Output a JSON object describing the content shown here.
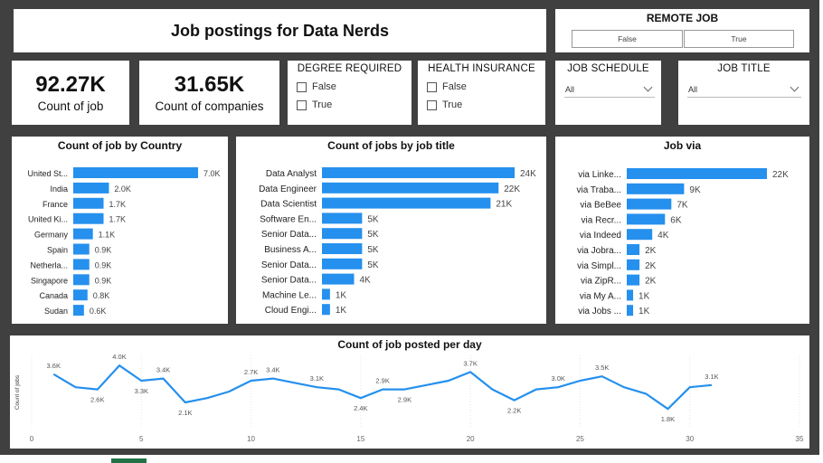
{
  "header": {
    "title": "Job postings for Data Nerds"
  },
  "remote": {
    "title": "REMOTE JOB",
    "options": [
      "False",
      "True"
    ]
  },
  "kpis": [
    {
      "value": "92.27K",
      "label": "Count of job"
    },
    {
      "value": "31.65K",
      "label": "Count of companies"
    }
  ],
  "degree": {
    "title": "DEGREE REQUIRED",
    "options": [
      "False",
      "True"
    ]
  },
  "health": {
    "title": "HEALTH INSURANCE",
    "options": [
      "False",
      "True"
    ]
  },
  "schedule": {
    "title": "JOB SCHEDULE",
    "value": "All"
  },
  "jobtitle": {
    "title": "JOB TITLE",
    "value": "All"
  },
  "colors": {
    "bar": "#2590ee",
    "background": "#404040"
  },
  "chart_data": [
    {
      "type": "bar",
      "orientation": "horizontal",
      "title": "Count of job by Country",
      "categories": [
        "United St...",
        "India",
        "France",
        "United Ki...",
        "Germany",
        "Spain",
        "Netherla...",
        "Singapore",
        "Canada",
        "Sudan"
      ],
      "values": [
        7.0,
        2.0,
        1.7,
        1.7,
        1.1,
        0.9,
        0.9,
        0.9,
        0.8,
        0.6
      ],
      "labels": [
        "7.0K",
        "2.0K",
        "1.7K",
        "1.7K",
        "1.1K",
        "0.9K",
        "0.9K",
        "0.9K",
        "0.8K",
        "0.6K"
      ],
      "max": 7.0
    },
    {
      "type": "bar",
      "orientation": "horizontal",
      "title": "Count of jobs by job title",
      "categories": [
        "Data Analyst",
        "Data Engineer",
        "Data Scientist",
        "Software En...",
        "Senior Data...",
        "Business A...",
        "Senior Data...",
        "Senior Data...",
        "Machine Le...",
        "Cloud Engi..."
      ],
      "values": [
        24,
        22,
        21,
        5,
        5,
        5,
        5,
        4,
        1,
        1
      ],
      "labels": [
        "24K",
        "22K",
        "21K",
        "5K",
        "5K",
        "5K",
        "5K",
        "4K",
        "1K",
        "1K"
      ],
      "max": 24
    },
    {
      "type": "bar",
      "orientation": "horizontal",
      "title": "Job via",
      "categories": [
        "via Linke...",
        "via Traba...",
        "via BeBee",
        "via Recr...",
        "via Indeed",
        "via Jobra...",
        "via Simpl...",
        "via ZipR...",
        "via My A...",
        "via Jobs ..."
      ],
      "values": [
        22,
        9,
        7,
        6,
        4,
        2,
        2,
        2,
        1,
        1
      ],
      "labels": [
        "22K",
        "9K",
        "7K",
        "6K",
        "4K",
        "2K",
        "2K",
        "2K",
        "1K",
        "1K"
      ],
      "max": 22
    },
    {
      "type": "line",
      "title": "Count of job posted per day",
      "ylabel": "Count of jobs",
      "xlabel": "",
      "x": [
        1,
        2,
        3,
        4,
        5,
        6,
        7,
        8,
        9,
        10,
        11,
        12,
        13,
        14,
        15,
        16,
        17,
        18,
        19,
        20,
        21,
        22,
        23,
        24,
        25,
        26,
        27,
        28,
        29,
        30,
        31
      ],
      "y": [
        3.6,
        3.0,
        2.9,
        4.0,
        3.3,
        3.4,
        2.3,
        2.5,
        2.8,
        3.3,
        3.4,
        3.2,
        3.0,
        2.9,
        2.5,
        2.9,
        2.9,
        3.1,
        3.3,
        3.7,
        2.9,
        2.4,
        2.9,
        3.0,
        3.3,
        3.5,
        3.0,
        2.7,
        2.0,
        3.0,
        3.1
      ],
      "point_labels": [
        {
          "x": 1,
          "text": "3.6K",
          "pos": "above"
        },
        {
          "x": 3,
          "text": "2.6K",
          "pos": "below"
        },
        {
          "x": 4,
          "text": "4.0K",
          "pos": "above"
        },
        {
          "x": 5,
          "text": "3.3K",
          "pos": "below"
        },
        {
          "x": 6,
          "text": "3.4K",
          "pos": "above"
        },
        {
          "x": 7,
          "text": "2.1K",
          "pos": "below"
        },
        {
          "x": 10,
          "text": "2.7K",
          "pos": "above"
        },
        {
          "x": 11,
          "text": "3.4K",
          "pos": "above"
        },
        {
          "x": 13,
          "text": "3.1K",
          "pos": "above"
        },
        {
          "x": 15,
          "text": "2.4K",
          "pos": "below"
        },
        {
          "x": 16,
          "text": "2.9K",
          "pos": "above"
        },
        {
          "x": 17,
          "text": "2.9K",
          "pos": "below"
        },
        {
          "x": 20,
          "text": "3.7K",
          "pos": "above"
        },
        {
          "x": 22,
          "text": "2.2K",
          "pos": "below"
        },
        {
          "x": 24,
          "text": "3.0K",
          "pos": "above"
        },
        {
          "x": 26,
          "text": "3.5K",
          "pos": "above"
        },
        {
          "x": 29,
          "text": "1.8K",
          "pos": "below"
        },
        {
          "x": 31,
          "text": "3.1K",
          "pos": "above"
        }
      ],
      "xticks": [
        0,
        5,
        10,
        15,
        20,
        25,
        30,
        35
      ],
      "xlim": [
        0,
        35
      ],
      "ylim": [
        1.3,
        4.3
      ],
      "grid": true
    }
  ]
}
